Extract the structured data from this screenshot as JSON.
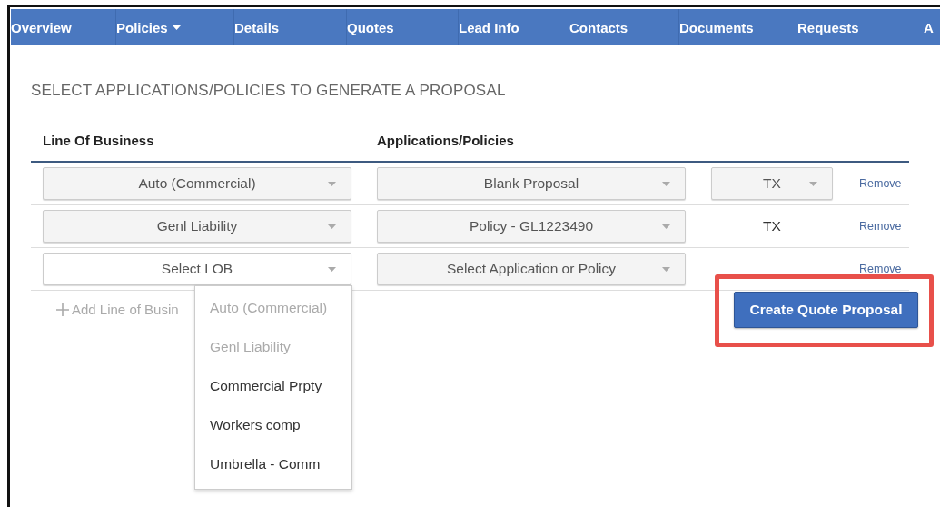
{
  "nav": {
    "tabs": [
      {
        "label": "Overview",
        "selected": false,
        "caret": false
      },
      {
        "label": "Policies",
        "selected": false,
        "caret": true
      },
      {
        "label": "Details",
        "selected": false,
        "caret": false
      },
      {
        "label": "Quotes",
        "selected": false,
        "caret": false
      },
      {
        "label": "Lead Info",
        "selected": false,
        "caret": false
      },
      {
        "label": "Contacts",
        "selected": false,
        "caret": false
      },
      {
        "label": "Documents",
        "selected": false,
        "caret": false
      },
      {
        "label": "Requests",
        "selected": false,
        "caret": false
      },
      {
        "label": "A",
        "selected": false,
        "caret": false
      }
    ]
  },
  "title": "SELECT APPLICATIONS/POLICIES TO GENERATE A PROPOSAL",
  "table": {
    "columns": [
      "Line Of Business",
      "Applications/Policies"
    ],
    "rows": [
      {
        "lob": {
          "value": "Auto (Commercial)",
          "expanded": false
        },
        "application": {
          "value": "Blank Proposal"
        },
        "state": {
          "kind": "select",
          "value": "TX"
        },
        "remove": "Remove"
      },
      {
        "lob": {
          "value": "Genl Liability",
          "expanded": false
        },
        "application": {
          "value": "Policy - GL1223490"
        },
        "state": {
          "kind": "text",
          "value": "TX"
        },
        "remove": "Remove"
      },
      {
        "lob": {
          "value": "Select LOB",
          "expanded": true
        },
        "application": {
          "value": "Select Application or Policy"
        },
        "state": {
          "kind": "none"
        },
        "remove": "Remove"
      }
    ]
  },
  "add_link": "Add Line of Busin",
  "lob_dropdown": {
    "options": [
      {
        "label": "Auto (Commercial)",
        "disabled": true
      },
      {
        "label": "Genl Liability",
        "disabled": true
      },
      {
        "label": "Commercial Prpty",
        "disabled": false
      },
      {
        "label": "Workers comp",
        "disabled": false
      },
      {
        "label": "Umbrella - Comm",
        "disabled": false
      }
    ]
  },
  "create_button": {
    "label": "Create Quote Proposal",
    "highlighted": true
  }
}
